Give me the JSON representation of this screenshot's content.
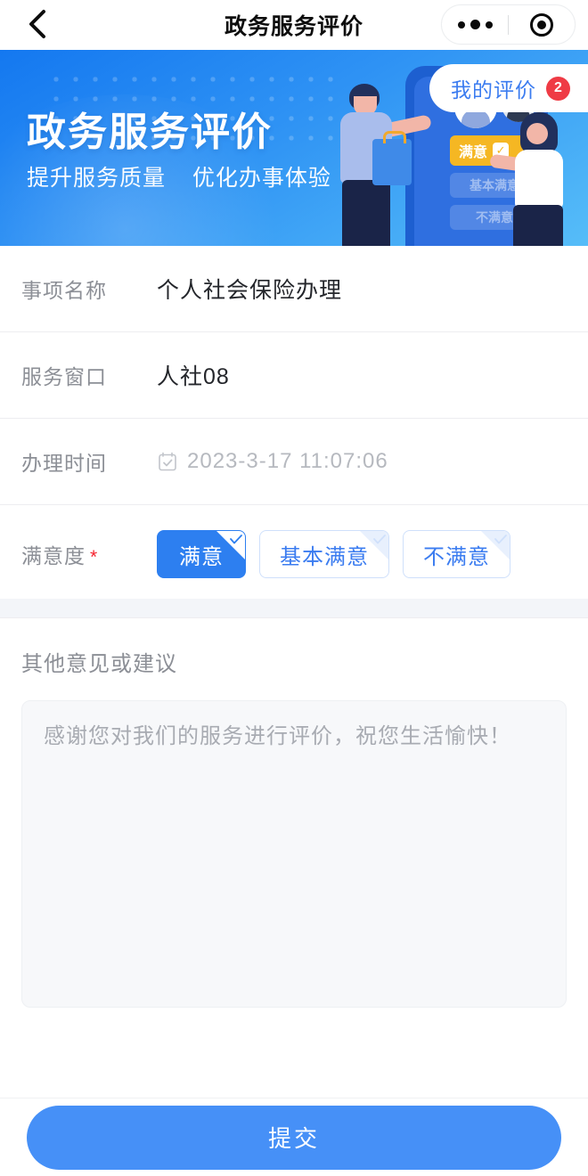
{
  "navbar": {
    "title": "政务服务评价",
    "back_icon": "chevron-left-icon",
    "menu_icon": "more-dots-icon",
    "close_icon": "target-circle-icon"
  },
  "banner": {
    "title": "政务服务评价",
    "subtitle_left": "提升服务质量",
    "subtitle_right": "优化办事体验",
    "illustration": {
      "option_selected": "满意",
      "option_two": "基本满意",
      "option_three": "不满意"
    }
  },
  "my_reviews": {
    "label": "我的评价",
    "badge": "2"
  },
  "form": {
    "rows": [
      {
        "label": "事项名称",
        "value": "个人社会保险办理"
      },
      {
        "label": "服务窗口",
        "value": "人社08"
      },
      {
        "label": "办理时间",
        "value": "2023-3-17 11:07:06"
      }
    ],
    "satisfaction": {
      "label": "满意度",
      "required_mark": "*",
      "options": [
        {
          "text": "满意",
          "selected": true
        },
        {
          "text": "基本满意",
          "selected": false
        },
        {
          "text": "不满意",
          "selected": false
        }
      ]
    }
  },
  "comment": {
    "label": "其他意见或建议",
    "value": "",
    "placeholder": "感谢您对我们的服务进行评价，祝您生活愉快！"
  },
  "footer": {
    "submit_label": "提交"
  },
  "colors": {
    "primary": "#2d7ff0",
    "link": "#3b7cf0",
    "badge": "#ef3b45",
    "required": "#f5222d",
    "submit": "#4690f7"
  }
}
